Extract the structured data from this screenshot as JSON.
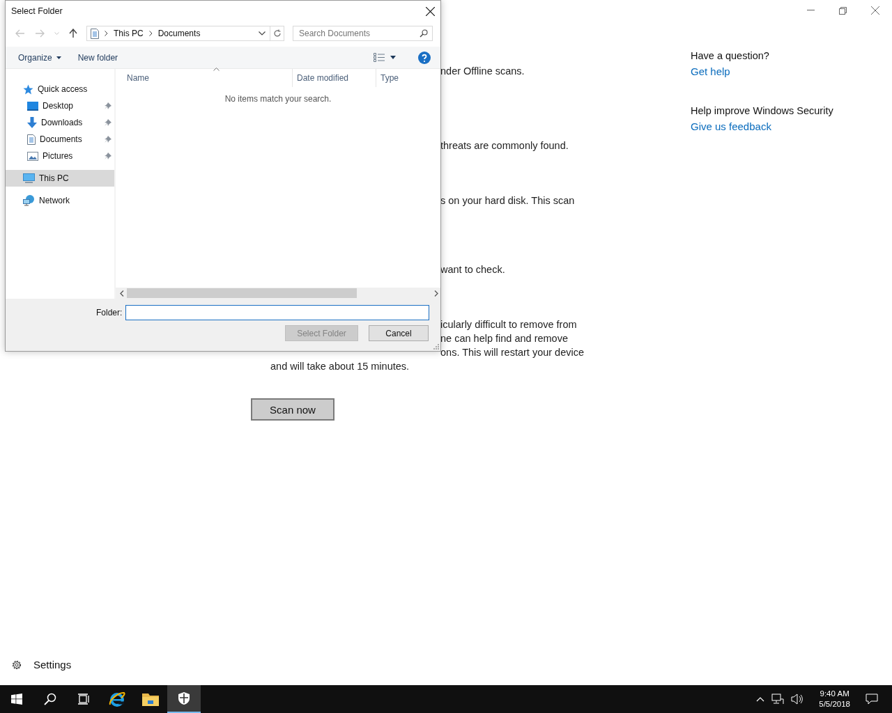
{
  "app": {
    "paragraphs": [
      {
        "lines": [
          {
            "kind": "cut",
            "text": "nder Offline scans."
          }
        ]
      },
      {
        "lines": [
          {
            "kind": "cut",
            "text": "threats are commonly found."
          }
        ]
      },
      {
        "lines": [
          {
            "kind": "cut",
            "text": "s on your hard disk. This scan"
          }
        ]
      },
      {
        "lines": [
          {
            "kind": "cut",
            "text": "want to check."
          }
        ]
      },
      {
        "lines": [
          {
            "kind": "cut",
            "text": "icularly difficult to remove from"
          },
          {
            "kind": "cut",
            "text": "ne can help find and remove"
          },
          {
            "kind": "cut",
            "text": "ons. This will restart your device"
          },
          {
            "kind": "whole",
            "text": "and will take about 15 minutes."
          }
        ]
      }
    ],
    "scan_button": "Scan now",
    "side_sections": [
      {
        "heading": "Have a question?",
        "link": "Get help"
      },
      {
        "heading": "Help improve Windows Security",
        "link": "Give us feedback"
      }
    ],
    "settings": "Settings"
  },
  "dialog": {
    "title": "Select Folder",
    "address": [
      "This PC",
      "Documents"
    ],
    "search": {
      "placeholder": "Search Documents"
    },
    "toolbar": {
      "organize": "Organize",
      "new_folder": "New folder"
    },
    "nav": [
      {
        "label": "Quick access",
        "kind": "star",
        "selected": false,
        "children": [
          {
            "label": "Desktop",
            "kind": "desktop",
            "pinned": true,
            "selected": false
          },
          {
            "label": "Downloads",
            "kind": "download",
            "pinned": true,
            "selected": false
          },
          {
            "label": "Documents",
            "kind": "document",
            "pinned": true,
            "selected": false
          },
          {
            "label": "Pictures",
            "kind": "pictures",
            "pinned": true,
            "selected": false
          }
        ]
      },
      {
        "label": "This PC",
        "kind": "pc",
        "selected": true
      },
      {
        "label": "Network",
        "kind": "network",
        "selected": false
      }
    ],
    "columns": [
      "Name",
      "Date modified",
      "Type"
    ],
    "empty_message": "No items match your search.",
    "folder_label": "Folder:",
    "buttons": [
      {
        "label": "Select Folder",
        "disabled": true
      },
      {
        "label": "Cancel",
        "disabled": false
      }
    ]
  },
  "taskbar": {
    "items": [
      {
        "kind": "start",
        "selected": false
      },
      {
        "kind": "search",
        "selected": false
      },
      {
        "kind": "taskview",
        "selected": false
      },
      {
        "kind": "browser",
        "selected": false
      },
      {
        "kind": "folder",
        "selected": false
      },
      {
        "kind": "shield",
        "selected": true
      }
    ],
    "time": "9:40 AM",
    "date": "5/5/2018"
  }
}
